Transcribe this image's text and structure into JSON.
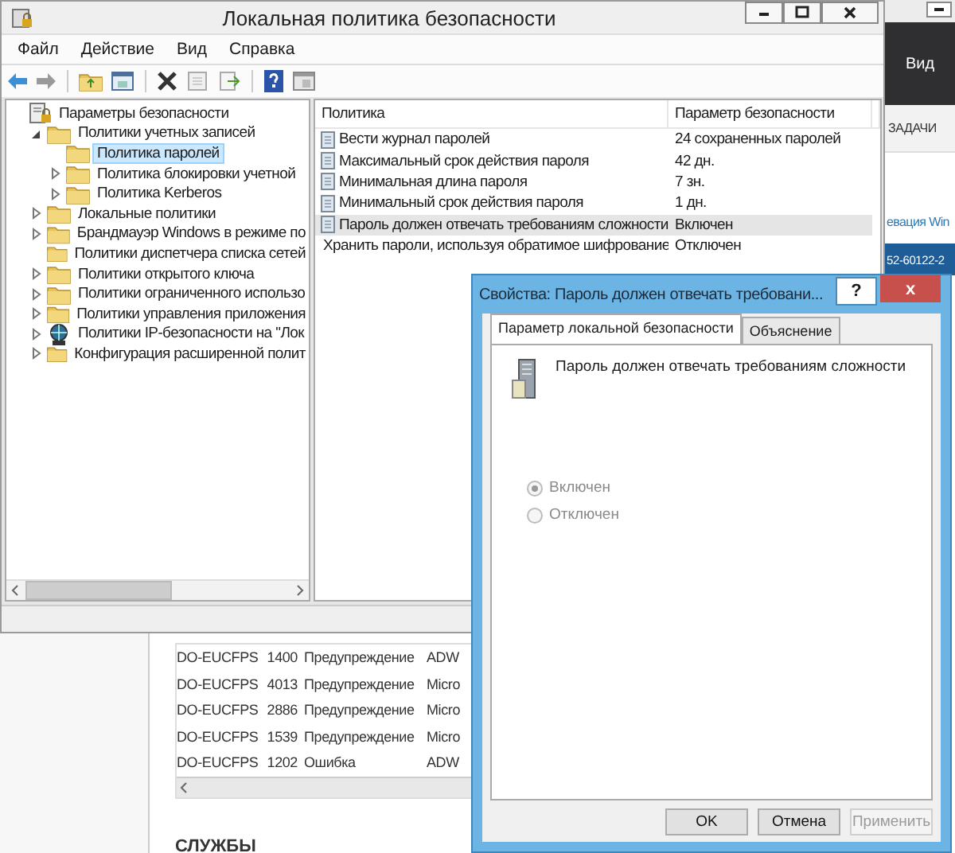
{
  "background_window": {
    "header_button": "Вид",
    "tasks_label": "ЗАДАЧИ",
    "link": "евация Win",
    "key_bar": "52-60122-2",
    "events": [
      {
        "server": "DO-EUCFPS",
        "id": "1400",
        "severity": "Предупреждение",
        "source": "ADW"
      },
      {
        "server": "DO-EUCFPS",
        "id": "4013",
        "severity": "Предупреждение",
        "source": "Micro"
      },
      {
        "server": "DO-EUCFPS",
        "id": "2886",
        "severity": "Предупреждение",
        "source": "Micro"
      },
      {
        "server": "DO-EUCFPS",
        "id": "1539",
        "severity": "Предупреждение",
        "source": "Micro"
      },
      {
        "server": "DO-EUCFPS",
        "id": "1202",
        "severity": "Ошибка",
        "source": "ADW"
      }
    ],
    "section_title": "СЛУЖБЫ"
  },
  "main_window": {
    "title": "Локальная политика безопасности",
    "menu": [
      "Файл",
      "Действие",
      "Вид",
      "Справка"
    ],
    "tree": [
      {
        "label": "Параметры безопасности",
        "kind": "security",
        "selected": false,
        "children": [
          {
            "label": "Политики учетных записей",
            "kind": "folder",
            "expanded": true,
            "selected": false,
            "children": [
              {
                "label": "Политика паролей",
                "kind": "folder",
                "selected": true
              },
              {
                "label": "Политика блокировки учетной",
                "kind": "folder",
                "expanded": false,
                "selected": false
              },
              {
                "label": "Политика Kerberos",
                "kind": "folder",
                "expanded": false,
                "selected": false
              }
            ]
          },
          {
            "label": "Локальные политики",
            "kind": "folder",
            "expanded": false,
            "selected": false
          },
          {
            "label": "Брандмауэр Windows в режиме по",
            "kind": "folder",
            "expanded": false,
            "selected": false
          },
          {
            "label": "Политики диспетчера списка сетей",
            "kind": "folder",
            "selected": false
          },
          {
            "label": "Политики открытого ключа",
            "kind": "folder",
            "expanded": false,
            "selected": false
          },
          {
            "label": "Политики ограниченного использо",
            "kind": "folder",
            "expanded": false,
            "selected": false
          },
          {
            "label": "Политики управления приложения",
            "kind": "folder",
            "expanded": false,
            "selected": false
          },
          {
            "label": "Политики IP-безопасности на \"Лок",
            "kind": "network",
            "expanded": false,
            "selected": false
          },
          {
            "label": "Конфигурация расширенной полит",
            "kind": "folder",
            "expanded": false,
            "selected": false
          }
        ]
      }
    ],
    "columns": [
      "Политика",
      "Параметр безопасности"
    ],
    "rows": [
      {
        "policy": "Вести журнал паролей",
        "setting": "24 сохраненных паролей",
        "selected": false
      },
      {
        "policy": "Максимальный срок действия пароля",
        "setting": "42 дн.",
        "selected": false
      },
      {
        "policy": "Минимальная длина пароля",
        "setting": "7 зн.",
        "selected": false
      },
      {
        "policy": "Минимальный срок действия пароля",
        "setting": "1 дн.",
        "selected": false
      },
      {
        "policy": "Пароль должен отвечать требованиям сложности",
        "setting": "Включен",
        "selected": true
      },
      {
        "policy": "Хранить пароли, используя обратимое шифрование",
        "setting": "Отключен",
        "selected": false
      }
    ]
  },
  "dialog": {
    "title": "Свойства: Пароль должен отвечать требовани...",
    "help_button": "?",
    "close_button": "x",
    "tabs": [
      {
        "label": "Параметр локальной безопасности",
        "selected": true
      },
      {
        "label": "Объяснение",
        "selected": false
      }
    ],
    "policy_name": "Пароль должен отвечать требованиям сложности",
    "options": [
      {
        "label": "Включен",
        "selected": true,
        "disabled": true
      },
      {
        "label": "Отключен",
        "selected": false,
        "disabled": true
      }
    ],
    "buttons": [
      {
        "label": "OK",
        "disabled": false
      },
      {
        "label": "Отмена",
        "disabled": false
      },
      {
        "label": "Применить",
        "disabled": true
      }
    ]
  }
}
